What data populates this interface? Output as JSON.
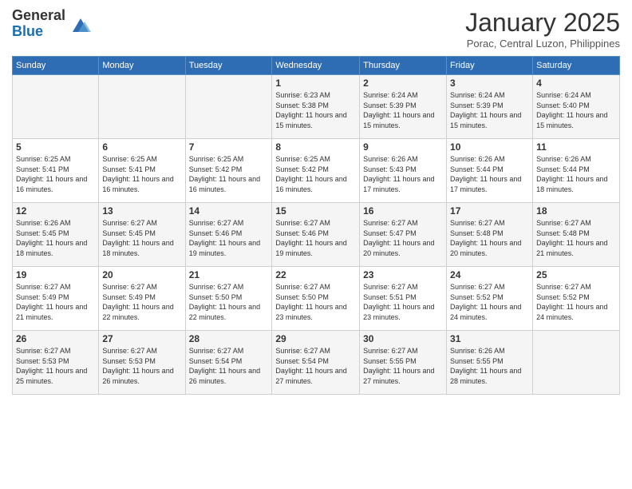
{
  "logo": {
    "general": "General",
    "blue": "Blue"
  },
  "title": "January 2025",
  "subtitle": "Porac, Central Luzon, Philippines",
  "weekdays": [
    "Sunday",
    "Monday",
    "Tuesday",
    "Wednesday",
    "Thursday",
    "Friday",
    "Saturday"
  ],
  "weeks": [
    [
      {
        "day": "",
        "sunrise": "",
        "sunset": "",
        "daylight": ""
      },
      {
        "day": "",
        "sunrise": "",
        "sunset": "",
        "daylight": ""
      },
      {
        "day": "",
        "sunrise": "",
        "sunset": "",
        "daylight": ""
      },
      {
        "day": "1",
        "sunrise": "Sunrise: 6:23 AM",
        "sunset": "Sunset: 5:38 PM",
        "daylight": "Daylight: 11 hours and 15 minutes."
      },
      {
        "day": "2",
        "sunrise": "Sunrise: 6:24 AM",
        "sunset": "Sunset: 5:39 PM",
        "daylight": "Daylight: 11 hours and 15 minutes."
      },
      {
        "day": "3",
        "sunrise": "Sunrise: 6:24 AM",
        "sunset": "Sunset: 5:39 PM",
        "daylight": "Daylight: 11 hours and 15 minutes."
      },
      {
        "day": "4",
        "sunrise": "Sunrise: 6:24 AM",
        "sunset": "Sunset: 5:40 PM",
        "daylight": "Daylight: 11 hours and 15 minutes."
      }
    ],
    [
      {
        "day": "5",
        "sunrise": "Sunrise: 6:25 AM",
        "sunset": "Sunset: 5:41 PM",
        "daylight": "Daylight: 11 hours and 16 minutes."
      },
      {
        "day": "6",
        "sunrise": "Sunrise: 6:25 AM",
        "sunset": "Sunset: 5:41 PM",
        "daylight": "Daylight: 11 hours and 16 minutes."
      },
      {
        "day": "7",
        "sunrise": "Sunrise: 6:25 AM",
        "sunset": "Sunset: 5:42 PM",
        "daylight": "Daylight: 11 hours and 16 minutes."
      },
      {
        "day": "8",
        "sunrise": "Sunrise: 6:25 AM",
        "sunset": "Sunset: 5:42 PM",
        "daylight": "Daylight: 11 hours and 16 minutes."
      },
      {
        "day": "9",
        "sunrise": "Sunrise: 6:26 AM",
        "sunset": "Sunset: 5:43 PM",
        "daylight": "Daylight: 11 hours and 17 minutes."
      },
      {
        "day": "10",
        "sunrise": "Sunrise: 6:26 AM",
        "sunset": "Sunset: 5:44 PM",
        "daylight": "Daylight: 11 hours and 17 minutes."
      },
      {
        "day": "11",
        "sunrise": "Sunrise: 6:26 AM",
        "sunset": "Sunset: 5:44 PM",
        "daylight": "Daylight: 11 hours and 18 minutes."
      }
    ],
    [
      {
        "day": "12",
        "sunrise": "Sunrise: 6:26 AM",
        "sunset": "Sunset: 5:45 PM",
        "daylight": "Daylight: 11 hours and 18 minutes."
      },
      {
        "day": "13",
        "sunrise": "Sunrise: 6:27 AM",
        "sunset": "Sunset: 5:45 PM",
        "daylight": "Daylight: 11 hours and 18 minutes."
      },
      {
        "day": "14",
        "sunrise": "Sunrise: 6:27 AM",
        "sunset": "Sunset: 5:46 PM",
        "daylight": "Daylight: 11 hours and 19 minutes."
      },
      {
        "day": "15",
        "sunrise": "Sunrise: 6:27 AM",
        "sunset": "Sunset: 5:46 PM",
        "daylight": "Daylight: 11 hours and 19 minutes."
      },
      {
        "day": "16",
        "sunrise": "Sunrise: 6:27 AM",
        "sunset": "Sunset: 5:47 PM",
        "daylight": "Daylight: 11 hours and 20 minutes."
      },
      {
        "day": "17",
        "sunrise": "Sunrise: 6:27 AM",
        "sunset": "Sunset: 5:48 PM",
        "daylight": "Daylight: 11 hours and 20 minutes."
      },
      {
        "day": "18",
        "sunrise": "Sunrise: 6:27 AM",
        "sunset": "Sunset: 5:48 PM",
        "daylight": "Daylight: 11 hours and 21 minutes."
      }
    ],
    [
      {
        "day": "19",
        "sunrise": "Sunrise: 6:27 AM",
        "sunset": "Sunset: 5:49 PM",
        "daylight": "Daylight: 11 hours and 21 minutes."
      },
      {
        "day": "20",
        "sunrise": "Sunrise: 6:27 AM",
        "sunset": "Sunset: 5:49 PM",
        "daylight": "Daylight: 11 hours and 22 minutes."
      },
      {
        "day": "21",
        "sunrise": "Sunrise: 6:27 AM",
        "sunset": "Sunset: 5:50 PM",
        "daylight": "Daylight: 11 hours and 22 minutes."
      },
      {
        "day": "22",
        "sunrise": "Sunrise: 6:27 AM",
        "sunset": "Sunset: 5:50 PM",
        "daylight": "Daylight: 11 hours and 23 minutes."
      },
      {
        "day": "23",
        "sunrise": "Sunrise: 6:27 AM",
        "sunset": "Sunset: 5:51 PM",
        "daylight": "Daylight: 11 hours and 23 minutes."
      },
      {
        "day": "24",
        "sunrise": "Sunrise: 6:27 AM",
        "sunset": "Sunset: 5:52 PM",
        "daylight": "Daylight: 11 hours and 24 minutes."
      },
      {
        "day": "25",
        "sunrise": "Sunrise: 6:27 AM",
        "sunset": "Sunset: 5:52 PM",
        "daylight": "Daylight: 11 hours and 24 minutes."
      }
    ],
    [
      {
        "day": "26",
        "sunrise": "Sunrise: 6:27 AM",
        "sunset": "Sunset: 5:53 PM",
        "daylight": "Daylight: 11 hours and 25 minutes."
      },
      {
        "day": "27",
        "sunrise": "Sunrise: 6:27 AM",
        "sunset": "Sunset: 5:53 PM",
        "daylight": "Daylight: 11 hours and 26 minutes."
      },
      {
        "day": "28",
        "sunrise": "Sunrise: 6:27 AM",
        "sunset": "Sunset: 5:54 PM",
        "daylight": "Daylight: 11 hours and 26 minutes."
      },
      {
        "day": "29",
        "sunrise": "Sunrise: 6:27 AM",
        "sunset": "Sunset: 5:54 PM",
        "daylight": "Daylight: 11 hours and 27 minutes."
      },
      {
        "day": "30",
        "sunrise": "Sunrise: 6:27 AM",
        "sunset": "Sunset: 5:55 PM",
        "daylight": "Daylight: 11 hours and 27 minutes."
      },
      {
        "day": "31",
        "sunrise": "Sunrise: 6:26 AM",
        "sunset": "Sunset: 5:55 PM",
        "daylight": "Daylight: 11 hours and 28 minutes."
      },
      {
        "day": "",
        "sunrise": "",
        "sunset": "",
        "daylight": ""
      }
    ]
  ]
}
